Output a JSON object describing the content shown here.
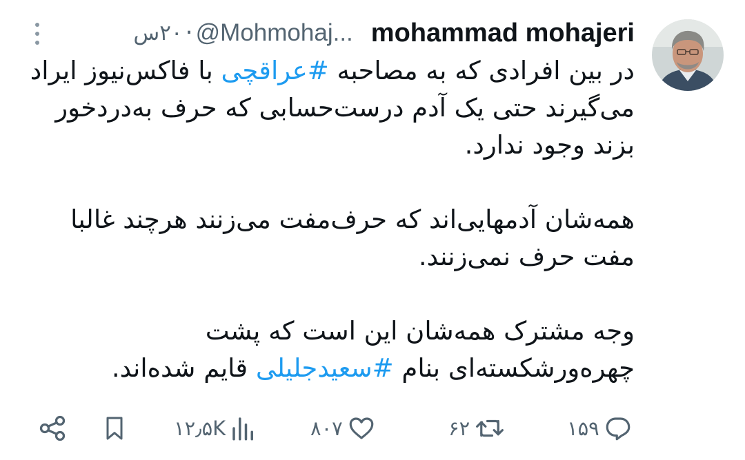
{
  "author": {
    "display_name": "mohammad mohajeri",
    "handle": "@Mohmohaj...",
    "separator": "·",
    "time": "۲۰س"
  },
  "tweet": {
    "paragraph_1": {
      "before": "در بین افرادی که به مصاحبه ",
      "hashtag": "#عراقچی",
      "after": " با فاکس‌نیوز ایراد می‌گیرند حتی یک آدم درست‌حسابی که حرف به‌دردخور بزند وجود ندارد."
    },
    "paragraph_2": "همه‌شان آدمهایی‌اند که حرف‌مفت می‌زنند هرچند غالبا مفت حرف نمی‌زنند.",
    "paragraph_3": {
      "before": "وجه مشترک همه‌شان این است که پشت چهره‌ورشکسته‌ای بنام ",
      "hashtag": "#سعیدجلیلی",
      "after": " قایم شده‌اند."
    }
  },
  "actions": {
    "replies": "۱۵۹",
    "retweets": "۶۲",
    "likes": "۸۰۷",
    "views": "۱۲٫۵K"
  },
  "colors": {
    "text": "#0f1419",
    "secondary": "#536471",
    "link": "#1d9bf0",
    "background": "#ffffff"
  },
  "icons": {
    "more": "more-vertical-icon",
    "reply": "reply-icon",
    "retweet": "retweet-icon",
    "like": "heart-icon",
    "views": "views-icon",
    "bookmark": "bookmark-icon",
    "share": "share-icon"
  }
}
